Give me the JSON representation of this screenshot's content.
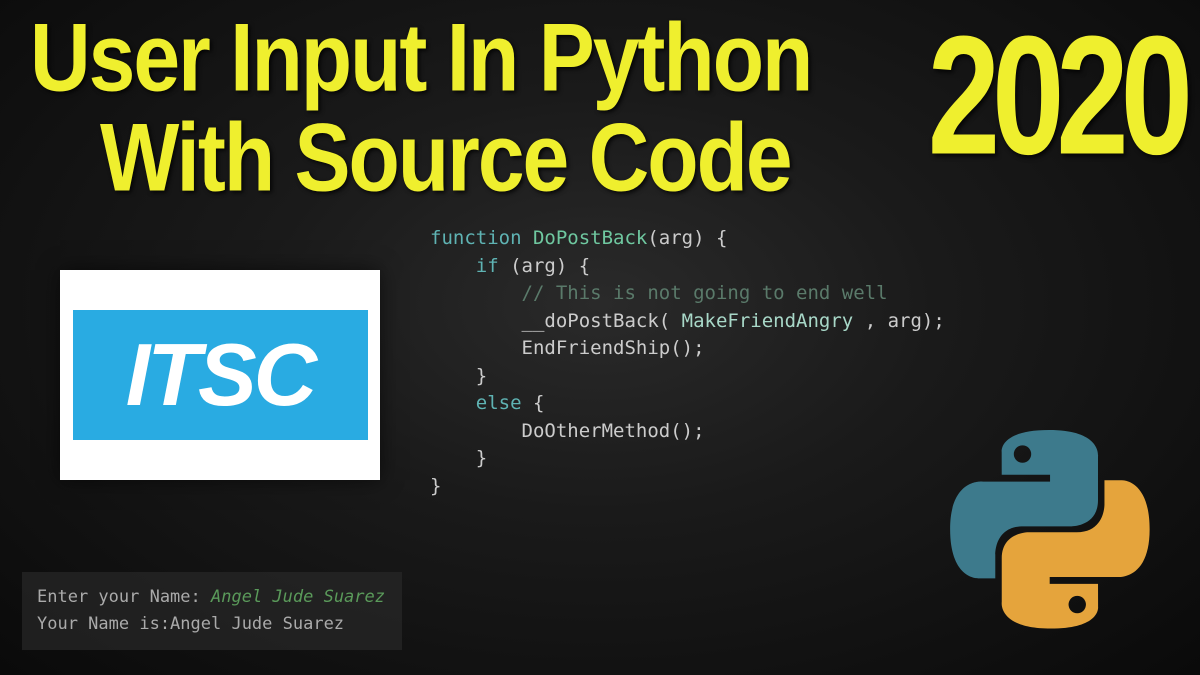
{
  "title": {
    "line1": "User Input In Python",
    "line2": "With Source Code"
  },
  "year": "2020",
  "logo": {
    "text": "ITSC"
  },
  "code": {
    "line1_kw": "function ",
    "line1_fn": "DoPostBack",
    "line1_rest": "(arg) {",
    "line2_kw": "    if ",
    "line2_rest": "(arg) {",
    "line3_comment": "        // This is not going to end well",
    "line4a": "        __doPostBack(",
    "line4b": " MakeFriendAngry ",
    "line4c": ", arg);",
    "line5": "        EndFriendShip();",
    "line6": "    }",
    "line7_kw": "    else ",
    "line7_rest": "{",
    "line8": "        DoOtherMethod();",
    "line9": "    }",
    "line10": "}"
  },
  "terminal": {
    "prompt": "Enter your Name: ",
    "input": "Angel Jude Suarez",
    "output": "Your Name is:Angel Jude Suarez"
  }
}
